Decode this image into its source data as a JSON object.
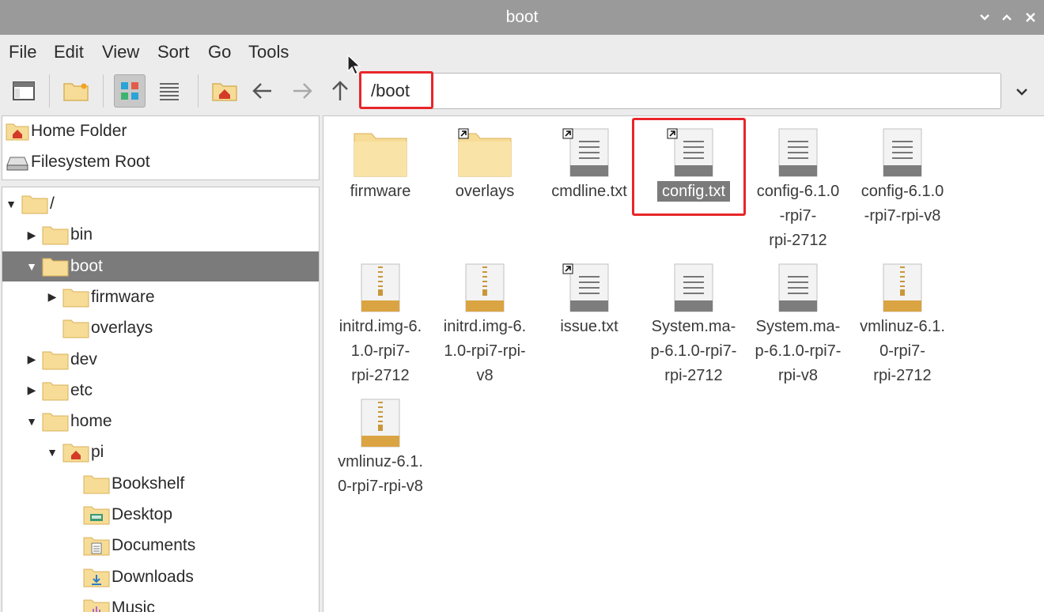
{
  "window": {
    "title": "boot",
    "controls": [
      "chevron-down-icon",
      "chevron-up-icon",
      "close-icon"
    ]
  },
  "menu": {
    "items": [
      "File",
      "Edit",
      "View",
      "Sort",
      "Go",
      "Tools"
    ]
  },
  "toolbar": {
    "path_value": "/boot",
    "buttons": [
      "new-window-icon",
      "new-folder-icon",
      "icon-view-icon",
      "list-view-icon",
      "home-icon",
      "back-arrow-icon",
      "forward-arrow-icon",
      "up-arrow-icon"
    ]
  },
  "places": {
    "home": "Home Folder",
    "root": "Filesystem Root"
  },
  "tree": {
    "rows": [
      {
        "label": "/",
        "expander": "open",
        "icon": "folder-icon"
      },
      {
        "label": "bin",
        "expander": "closed",
        "icon": "folder-icon"
      },
      {
        "label": "boot",
        "expander": "open",
        "icon": "folder-icon",
        "selected": true
      },
      {
        "label": "firmware",
        "expander": "closed",
        "icon": "folder-icon"
      },
      {
        "label": "overlays",
        "expander": "none",
        "icon": "folder-icon"
      },
      {
        "label": "dev",
        "expander": "closed",
        "icon": "folder-icon"
      },
      {
        "label": "etc",
        "expander": "closed",
        "icon": "folder-icon"
      },
      {
        "label": "home",
        "expander": "open",
        "icon": "folder-icon"
      },
      {
        "label": "pi",
        "expander": "open",
        "icon": "home-folder-icon"
      },
      {
        "label": "Bookshelf",
        "expander": "none",
        "icon": "folder-icon"
      },
      {
        "label": "Desktop",
        "expander": "none",
        "icon": "desktop-folder-icon"
      },
      {
        "label": "Documents",
        "expander": "none",
        "icon": "documents-folder-icon"
      },
      {
        "label": "Downloads",
        "expander": "none",
        "icon": "downloads-folder-icon"
      },
      {
        "label": "Music",
        "expander": "none",
        "icon": "music-folder-icon"
      }
    ]
  },
  "files": [
    {
      "name": "firmware",
      "lines": [
        "firmware"
      ],
      "kind": "folder",
      "link": false
    },
    {
      "name": "overlays",
      "lines": [
        "overlays"
      ],
      "kind": "folder",
      "link": true
    },
    {
      "name": "cmdline.txt",
      "lines": [
        "cmdline.txt"
      ],
      "kind": "text",
      "link": true
    },
    {
      "name": "config.txt",
      "lines": [
        "config.txt"
      ],
      "kind": "text",
      "link": true,
      "selected": true
    },
    {
      "name": "config-6.1.0-rpi7-rpi-2712",
      "lines": [
        "config-6.1.0",
        "-rpi7-",
        "rpi-2712"
      ],
      "kind": "text",
      "link": false
    },
    {
      "name": "config-6.1.0-rpi7-rpi-v8",
      "lines": [
        "config-6.1.0",
        "-rpi7-rpi-v8"
      ],
      "kind": "text",
      "link": false
    },
    {
      "name": "initrd.img-6.1.0-rpi7-rpi-2712",
      "lines": [
        "initrd.img-6.",
        "1.0-rpi7-",
        "rpi-2712"
      ],
      "kind": "archive",
      "link": false
    },
    {
      "name": "initrd.img-6.1.0-rpi7-rpi-v8",
      "lines": [
        "initrd.img-6.",
        "1.0-rpi7-rpi-",
        "v8"
      ],
      "kind": "archive",
      "link": false
    },
    {
      "name": "issue.txt",
      "lines": [
        "issue.txt"
      ],
      "kind": "text",
      "link": true
    },
    {
      "name": "System.map-6.1.0-rpi7-rpi-2712",
      "lines": [
        "System.ma-",
        "p-6.1.0-rpi7-",
        "rpi-2712"
      ],
      "kind": "text",
      "link": false
    },
    {
      "name": "System.map-6.1.0-rpi7-rpi-v8",
      "lines": [
        "System.ma-",
        "p-6.1.0-rpi7-",
        "rpi-v8"
      ],
      "kind": "text",
      "link": false
    },
    {
      "name": "vmlinuz-6.1.0-rpi7-rpi-2712",
      "lines": [
        "vmlinuz-6.1.",
        "0-rpi7-",
        "rpi-2712"
      ],
      "kind": "archive",
      "link": false
    },
    {
      "name": "vmlinuz-6.1.0-rpi7-rpi-v8",
      "lines": [
        "vmlinuz-6.1.",
        "0-rpi7-rpi-v8"
      ],
      "kind": "archive",
      "link": false
    }
  ],
  "colors": {
    "highlight": "#e8262a",
    "selection": "#7b7b7b",
    "folder": "#f6dc96",
    "titlebar": "#9a9a9a"
  }
}
